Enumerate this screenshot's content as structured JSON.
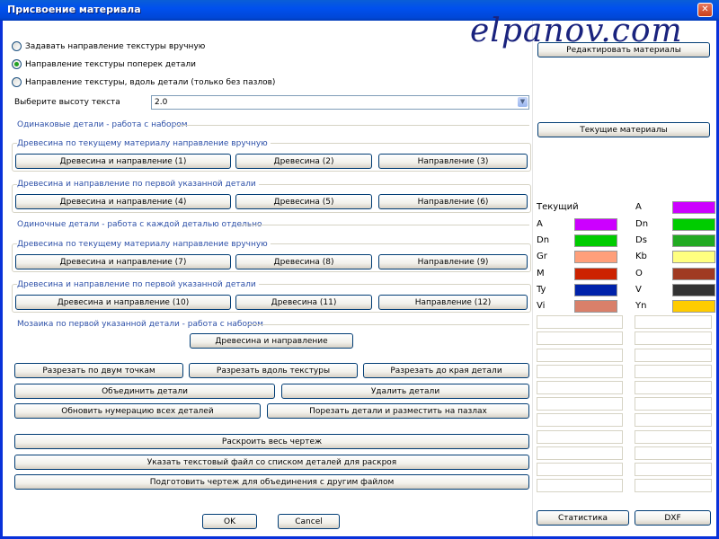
{
  "window": {
    "title": "Присвоение материала",
    "close_glyph": "✕"
  },
  "watermark": "elpanov.com",
  "radios": [
    {
      "label": "Задавать направление текстуры вручную",
      "checked": false
    },
    {
      "label": "Направление текстуры поперек детали",
      "checked": true
    },
    {
      "label": "Направление текстуры, вдоль детали (только без пазлов)",
      "checked": false
    }
  ],
  "text_height": {
    "label": "Выберите высоту текста",
    "value": "2.0"
  },
  "sections": {
    "same_parts": "Одинаковые детали - работа с набором",
    "single_parts": "Одиночные детали - работа с каждой деталью отдельно",
    "mosaic": "Мозаика по первой указанной детали - работа с набором"
  },
  "groups": {
    "g1": "Древесина по текущему материалу направление вручную",
    "g2": "Древесина и направление по первой указанной детали",
    "g3": "Древесина по текущему материалу направление вручную",
    "g4": "Древесина и направление по первой указанной детали"
  },
  "buttons": {
    "b1": "Древесина и направление (1)",
    "b2": "Древесина (2)",
    "b3": "Направление (3)",
    "b4": "Древесина и направление (4)",
    "b5": "Древесина (5)",
    "b6": "Направление (6)",
    "b7": "Древесина и направление (7)",
    "b8": "Древесина (8)",
    "b9": "Направление (9)",
    "b10": "Древесина и направление (10)",
    "b11": "Древесина (11)",
    "b12": "Направление (12)",
    "mosaic": "Древесина и направление",
    "cut_two_points": "Разрезать по двум точкам",
    "cut_along": "Разрезать вдоль текстуры",
    "cut_edge": "Разрезать до края детали",
    "merge": "Объединить детали",
    "delete": "Удалить детали",
    "renumber": "Обновить нумерацию всех деталей",
    "cut_puzzles": "Порезать детали и разместить на пазлах",
    "nest_all": "Раскроить весь чертеж",
    "text_file": "Указать текстовый файл со списком деталей для раскроя",
    "prepare": "Подготовить чертеж для объединения с другим файлом",
    "ok": "OK",
    "cancel": "Cancel",
    "edit_materials": "Редактировать материалы",
    "current_materials": "Текущие материалы",
    "statistics": "Статистика",
    "dxf": "DXF"
  },
  "materials": {
    "current_label": "Текущий",
    "current_code": "A",
    "current_color": "#cc00ff",
    "list": [
      {
        "code": "A",
        "color": "#cc00ff"
      },
      {
        "code": "Dn",
        "color": "#00cc00"
      },
      {
        "code": "Dn",
        "color": "#00cc00"
      },
      {
        "code": "Ds",
        "color": "#22aa22"
      },
      {
        "code": "Gr",
        "color": "#ff9f7a"
      },
      {
        "code": "Kb",
        "color": "#ffff80"
      },
      {
        "code": "M",
        "color": "#cc2200"
      },
      {
        "code": "O",
        "color": "#a03a22"
      },
      {
        "code": "Ty",
        "color": "#0022aa"
      },
      {
        "code": "V",
        "color": "#333333"
      },
      {
        "code": "Vi",
        "color": "#d9806a"
      },
      {
        "code": "Yn",
        "color": "#ffcc00"
      }
    ]
  }
}
